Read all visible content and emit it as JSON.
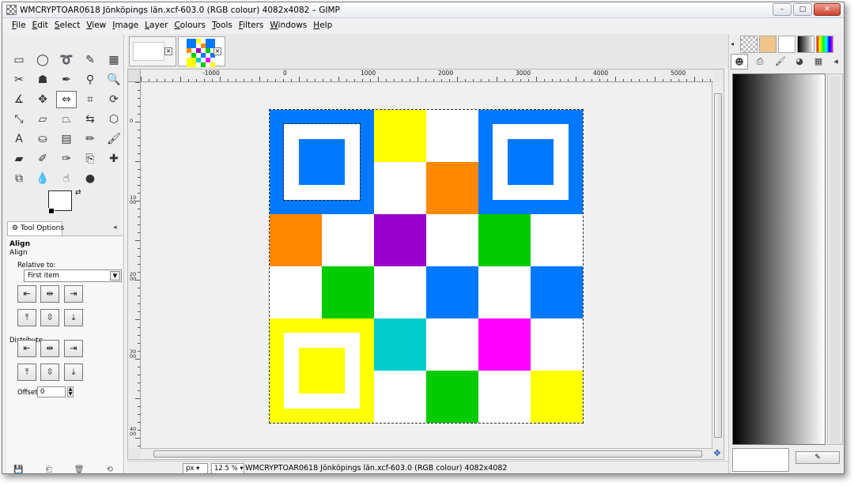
{
  "window": {
    "title": "WMCRYPTOAR0618 Jönköpings län.xcf-603.0 (RGB colour) 4082x4082 – GIMP",
    "controls": {
      "minimize": "–",
      "maximize": "□",
      "close": "✕"
    }
  },
  "menu": [
    {
      "label": "File",
      "u": "F",
      "rest": "ile"
    },
    {
      "label": "Edit",
      "u": "E",
      "rest": "dit"
    },
    {
      "label": "Select",
      "u": "S",
      "rest": "elect"
    },
    {
      "label": "View",
      "u": "V",
      "rest": "iew"
    },
    {
      "label": "Image",
      "u": "I",
      "rest": "mage"
    },
    {
      "label": "Layer",
      "u": "L",
      "rest": "ayer"
    },
    {
      "label": "Colours",
      "u": "C",
      "rest": "olours"
    },
    {
      "label": "Tools",
      "u": "T",
      "rest": "ools"
    },
    {
      "label": "Filters",
      "u": "F",
      "rest": "ilters"
    },
    {
      "label": "Windows",
      "u": "W",
      "rest": "indows"
    },
    {
      "label": "Help",
      "u": "H",
      "rest": "elp"
    }
  ],
  "tools": [
    {
      "name": "rect-select-tool-icon",
      "glyph": "▭"
    },
    {
      "name": "ellipse-select-tool-icon",
      "glyph": "◯"
    },
    {
      "name": "free-select-tool-icon",
      "glyph": "➰"
    },
    {
      "name": "fuzzy-select-tool-icon",
      "glyph": "✎"
    },
    {
      "name": "select-by-color-tool-icon",
      "glyph": "▦"
    },
    {
      "name": "scissors-tool-icon",
      "glyph": "✂"
    },
    {
      "name": "foreground-select-tool-icon",
      "glyph": "☗"
    },
    {
      "name": "paths-tool-icon",
      "glyph": "✒"
    },
    {
      "name": "color-picker-tool-icon",
      "glyph": "⚲"
    },
    {
      "name": "zoom-tool-icon",
      "glyph": "🔍"
    },
    {
      "name": "measure-tool-icon",
      "glyph": "∡"
    },
    {
      "name": "move-tool-icon",
      "glyph": "✥"
    },
    {
      "name": "align-tool-icon",
      "glyph": "⇔"
    },
    {
      "name": "crop-tool-icon",
      "glyph": "⌗"
    },
    {
      "name": "rotate-tool-icon",
      "glyph": "⟳"
    },
    {
      "name": "scale-tool-icon",
      "glyph": "⤡"
    },
    {
      "name": "shear-tool-icon",
      "glyph": "▱"
    },
    {
      "name": "perspective-tool-icon",
      "glyph": "⏢"
    },
    {
      "name": "flip-tool-icon",
      "glyph": "⇆"
    },
    {
      "name": "cage-tool-icon",
      "glyph": "⬡"
    },
    {
      "name": "text-tool-icon",
      "glyph": "A"
    },
    {
      "name": "bucket-fill-tool-icon",
      "glyph": "⛀"
    },
    {
      "name": "blend-tool-icon",
      "glyph": "▤"
    },
    {
      "name": "pencil-tool-icon",
      "glyph": "✏"
    },
    {
      "name": "paintbrush-tool-icon",
      "glyph": "🖌"
    },
    {
      "name": "eraser-tool-icon",
      "glyph": "▰"
    },
    {
      "name": "airbrush-tool-icon",
      "glyph": "✐"
    },
    {
      "name": "ink-tool-icon",
      "glyph": "✑"
    },
    {
      "name": "clone-tool-icon",
      "glyph": "⎘"
    },
    {
      "name": "heal-tool-icon",
      "glyph": "✚"
    },
    {
      "name": "perspective-clone-tool-icon",
      "glyph": "⧉"
    },
    {
      "name": "blur-tool-icon",
      "glyph": "💧"
    },
    {
      "name": "smudge-tool-icon",
      "glyph": "☝"
    },
    {
      "name": "dodge-burn-tool-icon",
      "glyph": "●"
    }
  ],
  "tool_options": {
    "tab_label": "Tool Options",
    "title": "Align",
    "subtitle": "Align",
    "relative_to_label": "Relative to:",
    "relative_to_value": "First item",
    "distribute_label": "Distribute",
    "offset_label": "Offset:",
    "offset_value": "0"
  },
  "image": {
    "selected_cell_colors_note": "",
    "colors": {
      "blue": "#0078ff",
      "yellow": "#ffff00",
      "orange": "#ff8800",
      "purple": "#9900cc",
      "green": "#00cc00",
      "cyan": "#00cccc",
      "magenta": "#ff00ff",
      "white": "#ffffff"
    },
    "grid": [
      [
        "F",
        "F",
        "yellow",
        "white",
        "F",
        "F"
      ],
      [
        "F",
        "F",
        "white",
        "orange",
        "F",
        "F"
      ],
      [
        "orange",
        "white",
        "purple",
        "white",
        "green",
        "white"
      ],
      [
        "white",
        "green",
        "white",
        "blue",
        "white",
        "blue"
      ],
      [
        "F",
        "F",
        "cyan",
        "white",
        "magenta",
        "white"
      ],
      [
        "F",
        "F",
        "white",
        "green",
        "white",
        "yellow"
      ]
    ],
    "finders": [
      {
        "pos": "top-left",
        "color": "blue"
      },
      {
        "pos": "top-right",
        "color": "blue"
      },
      {
        "pos": "bottom-left",
        "color": "yellow"
      }
    ]
  },
  "ruler": {
    "h_labels": [
      "-1000",
      "0",
      "1000",
      "2000",
      "3000",
      "4000",
      "5000"
    ],
    "v_labels": [
      "0",
      "1000",
      "2000",
      "3000",
      "4000"
    ]
  },
  "status": {
    "unit": "px",
    "zoom": "12.5 %",
    "text": "WMCRYPTOAR0618 Jönköpings län.xcf-603.0 (RGB colour) 4082x4082"
  }
}
